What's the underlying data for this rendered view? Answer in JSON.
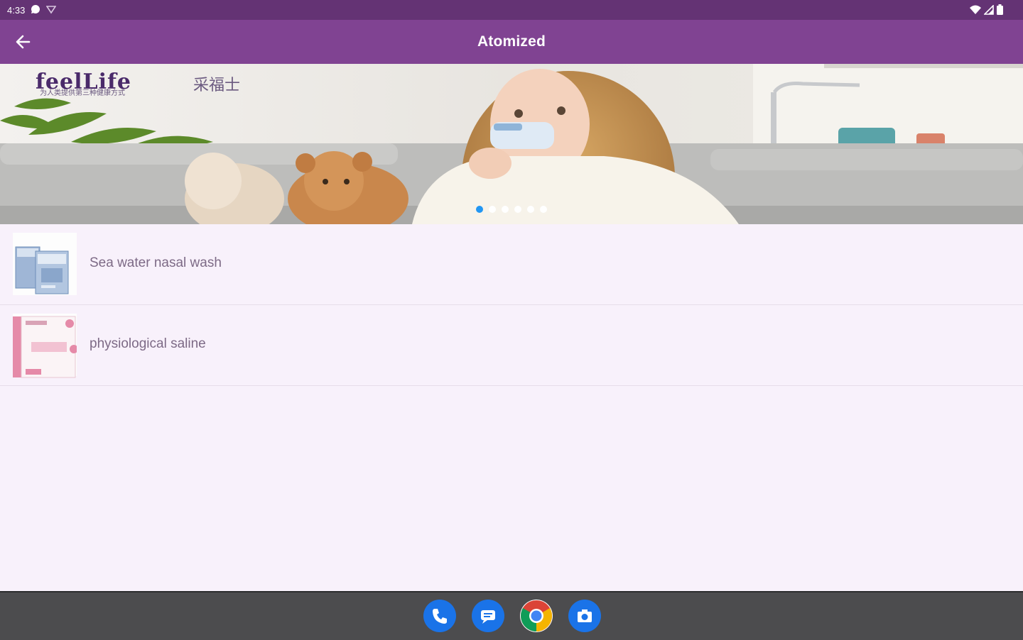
{
  "status_bar": {
    "time": "4:33",
    "icons": [
      "chat-notification-icon",
      "signal-alt-icon",
      "wifi-icon",
      "cellular-icon",
      "battery-icon"
    ]
  },
  "app_bar": {
    "title": "Atomized",
    "back_icon": "arrow-back-icon",
    "color": "#804392"
  },
  "banner": {
    "logo_text": "feelLife",
    "logo_cn": "采福士",
    "tagline": "为人类提供第三种健康方式",
    "slide_count": 6,
    "active_slide": 0
  },
  "products": [
    {
      "label": "Sea water nasal wash",
      "thumb_icon": "nasal-wash-box-icon"
    },
    {
      "label": "physiological saline",
      "thumb_icon": "saline-box-icon"
    }
  ],
  "dock": [
    {
      "name": "phone-app-icon"
    },
    {
      "name": "messages-app-icon"
    },
    {
      "name": "chrome-app-icon"
    },
    {
      "name": "camera-app-icon"
    }
  ],
  "colors": {
    "status_bar": "#643374",
    "background": "#f8f1fb",
    "dot_active": "#2196f3",
    "nav_bar": "#4c4c4e"
  }
}
